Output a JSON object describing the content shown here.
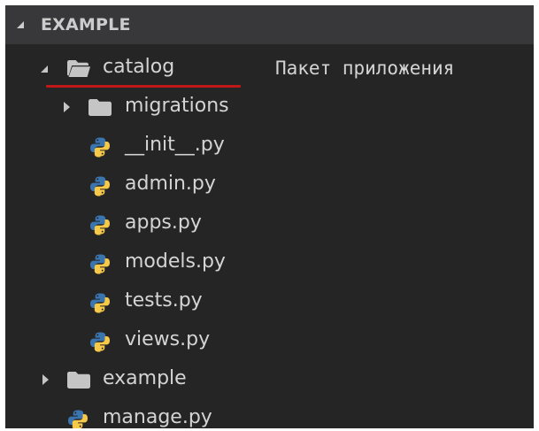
{
  "explorer": {
    "section_title": "EXAMPLE",
    "catalog": {
      "label": "catalog",
      "children": [
        {
          "label": "migrations",
          "type": "folder"
        },
        {
          "label": "__init__.py",
          "type": "python"
        },
        {
          "label": "admin.py",
          "type": "python"
        },
        {
          "label": "apps.py",
          "type": "python"
        },
        {
          "label": "models.py",
          "type": "python"
        },
        {
          "label": "tests.py",
          "type": "python"
        },
        {
          "label": "views.py",
          "type": "python"
        }
      ]
    },
    "example_folder": {
      "label": "example"
    },
    "manage_file": {
      "label": "manage.py"
    }
  },
  "annotation": {
    "text": "Пакет приложения",
    "underline_color": "#c01818"
  },
  "icons": {
    "folder": "folder-icon",
    "folder_open": "folder-open-icon",
    "python": "python-file-icon",
    "twisty_open": "chevron-down-icon",
    "twisty_closed": "chevron-right-icon"
  },
  "colors": {
    "panel_bg": "#252526",
    "header_bg": "#38383a",
    "text": "#d4d4d4",
    "folder": "#c5c5c5",
    "python_blue": "#3a75b0",
    "python_yellow": "#f7c948"
  }
}
